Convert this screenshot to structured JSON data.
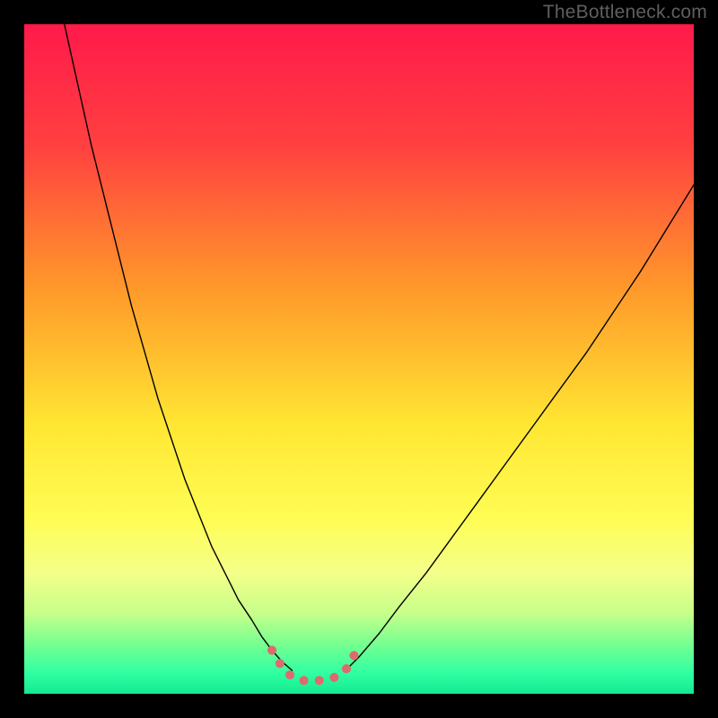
{
  "watermark": "TheBottleneck.com",
  "chart_data": {
    "type": "line",
    "title": "",
    "xlabel": "",
    "ylabel": "",
    "xlim": [
      0,
      100
    ],
    "ylim": [
      0,
      100
    ],
    "grid": false,
    "legend": false,
    "background": {
      "stops": [
        {
          "pct": 0,
          "color": "#ff1a4a"
        },
        {
          "pct": 18,
          "color": "#ff4040"
        },
        {
          "pct": 40,
          "color": "#ff9b2a"
        },
        {
          "pct": 60,
          "color": "#ffe733"
        },
        {
          "pct": 74,
          "color": "#fffd55"
        },
        {
          "pct": 82,
          "color": "#f3ff8a"
        },
        {
          "pct": 88,
          "color": "#c6ff8a"
        },
        {
          "pct": 93,
          "color": "#6fff91"
        },
        {
          "pct": 97,
          "color": "#2fffa3"
        },
        {
          "pct": 100,
          "color": "#14e88f"
        }
      ]
    },
    "series": [
      {
        "name": "left-branch",
        "x": [
          6,
          8,
          10,
          12,
          14,
          16,
          18,
          20,
          22,
          24,
          26,
          28,
          30,
          32,
          34,
          35.5,
          37,
          38.5,
          40
        ],
        "y": [
          100,
          91,
          82,
          74,
          66,
          58,
          51,
          44,
          38,
          32,
          27,
          22,
          18,
          14,
          11,
          8.5,
          6.5,
          4.8,
          3.5
        ],
        "color": "#000000",
        "width": 1.4
      },
      {
        "name": "right-branch",
        "x": [
          48,
          50,
          53,
          56,
          60,
          64,
          68,
          72,
          76,
          80,
          84,
          88,
          92,
          96,
          100
        ],
        "y": [
          3.5,
          5.5,
          9,
          13,
          18,
          23.5,
          29,
          34.5,
          40,
          45.5,
          51,
          57,
          63,
          69.5,
          76
        ],
        "color": "#000000",
        "width": 1.4
      },
      {
        "name": "highlight",
        "x": [
          37,
          38.5,
          40,
          41.5,
          43,
          44.5,
          46,
          47.5,
          48.5,
          49.5
        ],
        "y": [
          6.5,
          4,
          2.5,
          2,
          2,
          2,
          2.3,
          3.0,
          4.2,
          6.2
        ],
        "color": "#de6a6d",
        "width": 10,
        "dotted": true
      }
    ]
  }
}
